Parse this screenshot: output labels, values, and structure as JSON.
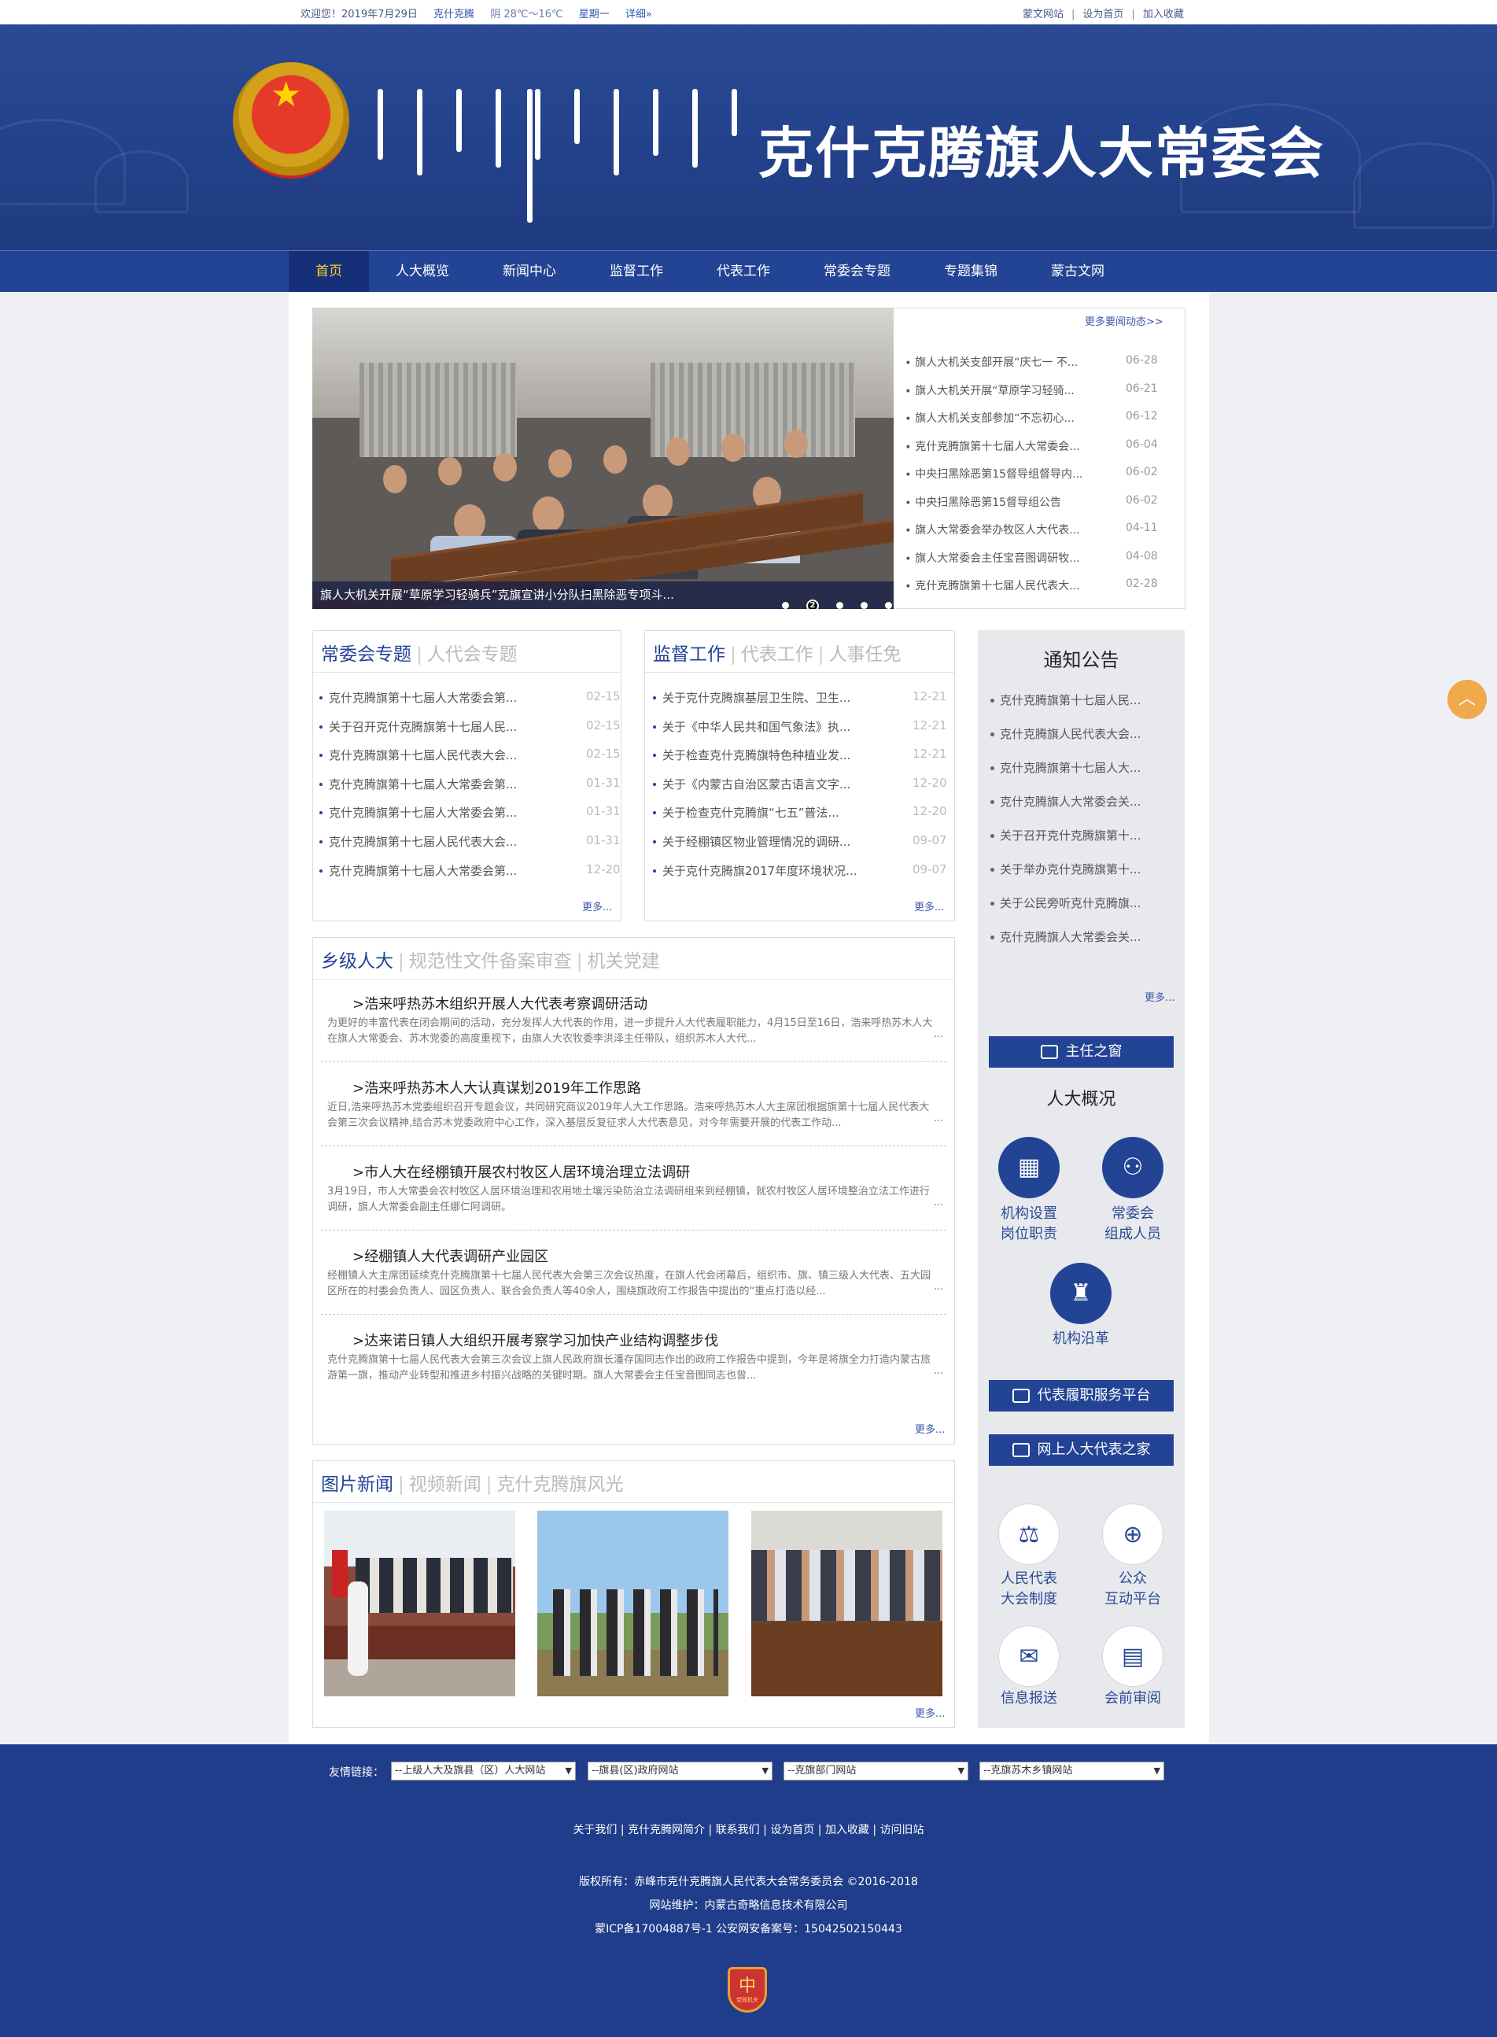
{
  "topbar": {
    "welcome": "欢迎您！2019年7月29日",
    "location": "克什克腾",
    "weather": "阴 28℃～16℃",
    "weekday": "星期一",
    "detail": "详细»",
    "mongol_site": "蒙文网站",
    "set_home": "设为首页",
    "favorite": "加入收藏"
  },
  "header": {
    "title": "克什克腾旗人大常委会"
  },
  "nav": [
    "首页",
    "人大概览",
    "新闻中心",
    "监督工作",
    "代表工作",
    "常委会专题",
    "专题集锦",
    "蒙古文网"
  ],
  "slider": {
    "caption": "旗人大机关开展“草原学习轻骑兵”克旗宣讲小分队扫黑除恶专项斗...",
    "active_index": "2"
  },
  "news": {
    "more": "更多要闻动态>>",
    "items": [
      {
        "t": "旗人大机关支部开展“庆七一 不...",
        "d": "06-28"
      },
      {
        "t": "旗人大机关开展“草原学习轻骑...",
        "d": "06-21"
      },
      {
        "t": "旗人大机关支部参加“不忘初心...",
        "d": "06-12"
      },
      {
        "t": "克什克腾旗第十七届人大常委会...",
        "d": "06-04"
      },
      {
        "t": "中央扫黑除恶第15督导组督导内...",
        "d": "06-02"
      },
      {
        "t": "中央扫黑除恶第15督导组公告",
        "d": "06-02"
      },
      {
        "t": "旗人大常委会举办牧区人大代表...",
        "d": "04-11"
      },
      {
        "t": "旗人大常委会主任宝音图调研牧...",
        "d": "04-08"
      },
      {
        "t": "克什克腾旗第十七届人民代表大...",
        "d": "02-28"
      }
    ]
  },
  "box1": {
    "tabs": [
      "常委会专题",
      "人代会专题"
    ],
    "more": "更多...",
    "items": [
      {
        "t": "克什克腾旗第十七届人大常委会第...",
        "d": "02-15"
      },
      {
        "t": "关于召开克什克腾旗第十七届人民...",
        "d": "02-15"
      },
      {
        "t": "克什克腾旗第十七届人民代表大会...",
        "d": "02-15"
      },
      {
        "t": "克什克腾旗第十七届人大常委会第...",
        "d": "01-31"
      },
      {
        "t": "克什克腾旗第十七届人大常委会第...",
        "d": "01-31"
      },
      {
        "t": "克什克腾旗第十七届人民代表大会...",
        "d": "01-31"
      },
      {
        "t": "克什克腾旗第十七届人大常委会第...",
        "d": "12-20"
      }
    ]
  },
  "box2": {
    "tabs": [
      "监督工作",
      "代表工作",
      "人事任免"
    ],
    "more": "更多...",
    "items": [
      {
        "t": "关于克什克腾旗基层卫生院、卫生...",
        "d": "12-21"
      },
      {
        "t": "关于《中华人民共和国气象法》执...",
        "d": "12-21"
      },
      {
        "t": "关于检查克什克腾旗特色种植业发...",
        "d": "12-21"
      },
      {
        "t": "关于《内蒙古自治区蒙古语言文字...",
        "d": "12-20"
      },
      {
        "t": "关于检查克什克腾旗“七五”普法...",
        "d": "12-20"
      },
      {
        "t": "关于经棚镇区物业管理情况的调研...",
        "d": "09-07"
      },
      {
        "t": "关于克什克腾旗2017年度环境状况...",
        "d": "09-07"
      }
    ]
  },
  "notice": {
    "title": "通知公告",
    "more": "更多...",
    "items": [
      "克什克腾旗第十七届人民...",
      "克什克腾旗人民代表大会...",
      "克什克腾旗第十七届人大...",
      "克什克腾旗人大常委会关...",
      "关于召开克什克腾旗第十...",
      "关于举办克什克腾旗第十...",
      "关于公民旁听克什克腾旗...",
      "克什克腾旗人大常委会关..."
    ]
  },
  "sidebar": {
    "director": "主任之窗",
    "overview_title": "人大概况",
    "org": "机构设置岗位职责",
    "org1": "机构设置",
    "org2": "岗位职责",
    "members1": "常委会",
    "members2": "组成人员",
    "history": "机构沿革",
    "duty_platform": "代表履职服务平台",
    "online_home": "网上人大代表之家",
    "sys1": "人民代表",
    "sys2": "大会制度",
    "pub1": "公众",
    "pub2": "互动平台",
    "info": "信息报送",
    "review": "会前审阅"
  },
  "rural": {
    "tabs": [
      "乡级人大",
      "规范性文件备案审查",
      "机关党建"
    ],
    "more": "更多...",
    "items": [
      {
        "t": ">浩来呼热苏木组织开展人大代表考察调研活动",
        "p": "为更好的丰富代表在闭会期间的活动，充分发挥人大代表的作用，进一步提升人大代表履职能力，4月15日至16日，浩来呼热苏木人大在旗人大常委会、苏木党委的高度重视下，由旗人大农牧委李洪泽主任带队，组织苏木人大代...",
        "e": "..."
      },
      {
        "t": ">浩来呼热苏木人大认真谋划2019年工作思路",
        "p": "近日,浩来呼热苏木党委组织召开专题会议，共同研究商议2019年人大工作思路。浩来呼热苏木人大主席团根据旗第十七届人民代表大会第三次会议精神,结合苏木党委政府中心工作，深入基层反复征求人大代表意见，对今年需要开展的代表工作动...",
        "e": "..."
      },
      {
        "t": ">市人大在经棚镇开展农村牧区人居环境治理立法调研",
        "p": "3月19日，市人大常委会农村牧区人居环境治理和农用地土壤污染防治立法调研组来到经棚镇，就农村牧区人居环境整治立法工作进行调研，旗人大常委会副主任娜仁阿调研。",
        "e": "..."
      },
      {
        "t": ">经棚镇人大代表调研产业园区",
        "p": "经棚镇人大主席团延续克什克腾旗第十七届人民代表大会第三次会议热度，在旗人代会闭幕后，组织市、旗、镇三级人大代表、五大园区所在的村委会负责人、园区负责人、联合会负责人等40余人，围绕旗政府工作报告中提出的“重点打造以经...",
        "e": "..."
      },
      {
        "t": ">达来诺日镇人大组织开展考察学习加快产业结构调整步伐",
        "p": "克什克腾旗第十七届人民代表大会第三次会议上旗人民政府旗长潘存国同志作出的政府工作报告中提到，今年是将旗全力打造内蒙古旅游第一旗，推动产业转型和推进乡村振兴战略的关键时期。旗人大常委会主任宝音图同志也曾...",
        "e": "..."
      }
    ]
  },
  "photo": {
    "tabs": [
      "图片新闻",
      "视频新闻",
      "克什克腾旗风光"
    ],
    "more": "更多..."
  },
  "footer": {
    "friend_label": "友情链接：",
    "selects": [
      "--上级人大及旗县（区）人大网站",
      "--旗县(区)政府网站",
      "--克旗部门网站",
      "--克旗苏木乡镇网站"
    ],
    "links": [
      "关于我们",
      "克什克腾网简介",
      "联系我们",
      "设为首页",
      "加入收藏",
      "访问旧站"
    ],
    "copyright": "版权所有：赤峰市克什克腾旗人民代表大会常务委员会 ©2016-2018",
    "maintain": "网站维护：内蒙古奇略信息技术有限公司",
    "icp": "蒙ICP备17004887号-1 公安网安备案号：15042502150443",
    "badge": "党政机关"
  },
  "colors": {
    "primary": "#234394",
    "nav_active": "#ffcc33",
    "accent": "#f1a94e"
  }
}
